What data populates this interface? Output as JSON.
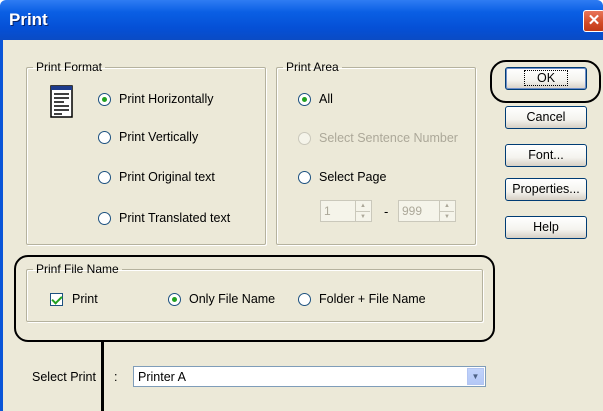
{
  "window": {
    "title": "Print",
    "close_glyph": "✕"
  },
  "print_format": {
    "legend": "Print Format",
    "icon": "document-lines-icon",
    "options": [
      {
        "label": "Print Horizontally",
        "checked": true
      },
      {
        "label": "Print Vertically",
        "checked": false
      },
      {
        "label": "Print Original text",
        "checked": false
      },
      {
        "label": "Print Translated text",
        "checked": false
      }
    ]
  },
  "print_area": {
    "legend": "Print Area",
    "options": [
      {
        "label": "All",
        "checked": true,
        "enabled": true
      },
      {
        "label": "Select Sentence Number",
        "checked": false,
        "enabled": false
      },
      {
        "label": "Select Page",
        "checked": false,
        "enabled": true
      }
    ],
    "page_from": "1",
    "page_separator": "-",
    "page_to": "999"
  },
  "print_file_name": {
    "legend": "Prinf File Name",
    "print_checkbox": {
      "label": "Print",
      "checked": true
    },
    "options": [
      {
        "label": "Only File Name",
        "checked": true
      },
      {
        "label": "Folder + File Name",
        "checked": false
      }
    ]
  },
  "select_print": {
    "label": "Select Print",
    "separator": ":",
    "value": "Printer A"
  },
  "buttons": {
    "ok": "OK",
    "cancel": "Cancel",
    "font": "Font...",
    "properties": "Properties...",
    "help": "Help"
  },
  "colors": {
    "titlebar": "#0a5fe4",
    "dialog_bg": "#ece9d8",
    "radio_dot": "#21a121",
    "close_button": "#d24a26"
  }
}
